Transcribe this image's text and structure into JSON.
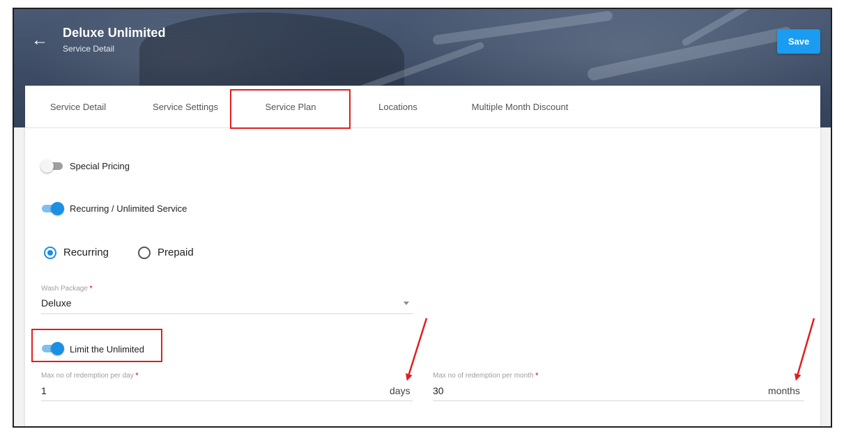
{
  "header": {
    "title": "Deluxe Unlimited",
    "subtitle": "Service Detail",
    "back_icon": "arrow-left-icon",
    "save_label": "Save"
  },
  "tabs": [
    {
      "label": "Service Detail"
    },
    {
      "label": "Service Settings"
    },
    {
      "label": "Service Plan",
      "selected": true
    },
    {
      "label": "Locations"
    },
    {
      "label": "Multiple Month Discount"
    }
  ],
  "toggles": {
    "special_pricing": {
      "label": "Special Pricing",
      "on": false
    },
    "recurring_unlimited": {
      "label": "Recurring / Unlimited Service",
      "on": true
    },
    "limit_unlimited": {
      "label": "Limit the Unlimited",
      "on": true
    }
  },
  "plan_type": {
    "options": [
      {
        "label": "Recurring",
        "checked": true
      },
      {
        "label": "Prepaid",
        "checked": false
      }
    ]
  },
  "wash_package": {
    "label": "Wash Package",
    "required_mark": "*",
    "value": "Deluxe"
  },
  "max_per_day": {
    "label": "Max no of redemption per day",
    "required_mark": "*",
    "value": "1",
    "unit": "days"
  },
  "max_per_month": {
    "label": "Max no of redemption per month",
    "required_mark": "*",
    "value": "30",
    "unit": "months"
  },
  "colors": {
    "accent": "#1a8fe3",
    "save_button": "#1a9cf0",
    "annotation_red": "#e01e1e",
    "required_red": "#e53935"
  }
}
